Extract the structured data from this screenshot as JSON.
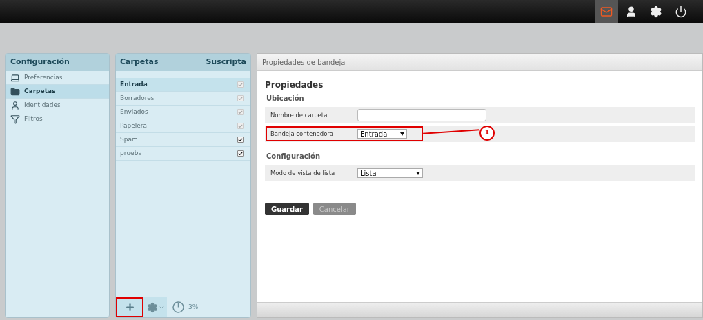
{
  "top_bar": {
    "icons": [
      {
        "kind": "mail",
        "selected": true
      },
      {
        "kind": "user",
        "selected": false
      },
      {
        "kind": "settings",
        "selected": false
      },
      {
        "kind": "power",
        "selected": false
      }
    ]
  },
  "config_panel": {
    "title": "Configuración",
    "items": [
      {
        "kind": "laptop",
        "label": "Preferencias",
        "selected": false
      },
      {
        "kind": "folder",
        "label": "Carpetas",
        "selected": true
      },
      {
        "kind": "user",
        "label": "Identidades",
        "selected": false
      },
      {
        "kind": "filter",
        "label": "Filtros",
        "selected": false
      }
    ]
  },
  "folders_panel": {
    "title": "Carpetas",
    "column": "Suscripta",
    "rows": [
      {
        "name": "Entrada",
        "selected": true,
        "checked": true,
        "disabled": true
      },
      {
        "name": "Borradores",
        "selected": false,
        "checked": true,
        "disabled": true
      },
      {
        "name": "Enviados",
        "selected": false,
        "checked": true,
        "disabled": true
      },
      {
        "name": "Papelera",
        "selected": false,
        "checked": true,
        "disabled": true
      },
      {
        "name": "Spam",
        "selected": false,
        "checked": true,
        "disabled": false
      },
      {
        "name": "prueba",
        "selected": false,
        "checked": true,
        "disabled": false
      }
    ],
    "quota": "3%"
  },
  "properties": {
    "header": "Propiedades de bandeja",
    "title": "Propiedades",
    "sections": [
      {
        "title": "Ubicación",
        "fields": [
          {
            "kind": "text",
            "label": "Nombre de carpeta"
          },
          {
            "kind": "select",
            "label": "Bandeja contenedora",
            "value": "Entrada",
            "callout": "1"
          }
        ]
      },
      {
        "title": "Configuración",
        "fields": [
          {
            "kind": "select",
            "label": "Modo de vista de lista",
            "value": "Lista"
          }
        ]
      }
    ],
    "buttons": [
      {
        "label": "Guardar",
        "disabled": false
      },
      {
        "label": "Cancelar",
        "disabled": true
      }
    ]
  }
}
